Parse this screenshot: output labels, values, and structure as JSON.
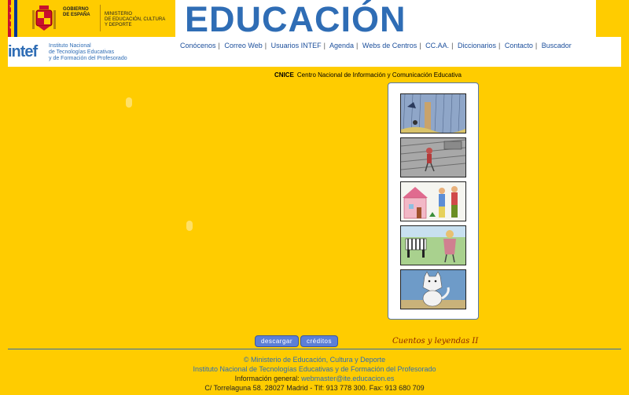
{
  "header": {
    "gov_line1": "GOBIERNO",
    "gov_line2": "DE ESPAÑA",
    "min_line1": "MINISTERIO",
    "min_line2": "DE EDUCACIÓN, CULTURA",
    "min_line3": "Y DEPORTE",
    "banner_title": "EDUCACIÓN"
  },
  "intef": {
    "logo": "intef",
    "line1": "Instituto Nacional",
    "line2": "de Tecnologías Educativas",
    "line3": "y de Formación del Profesorado"
  },
  "nav": {
    "items": [
      "Conócenos",
      "Correo Web",
      "Usuarios INTEF",
      "Agenda",
      "Webs de Centros",
      "CC.AA.",
      "Diccionarios",
      "Contacto",
      "Buscador"
    ]
  },
  "cnice": {
    "abbr": "CNICE",
    "full": "Centro Nacional de Información y Comunicación Educativa"
  },
  "buttons": {
    "download": "descargar",
    "credits": "créditos"
  },
  "series_title": "Cuentos y leyendas II",
  "footer": {
    "line1": "© Ministerio de Educación, Cultura y Deporte",
    "line2": "Instituto Nacional de Tecnologías Educativas y de Formación del Profesorado",
    "info_label": "Información general: ",
    "info_email": "webmaster@ite.educacion.es",
    "address": "C/ Torrelaguna 58. 28027 Madrid - Tlf: 913 778 300. Fax: 913 680 709"
  },
  "colors": {
    "background": "#FFCC00",
    "accent_blue": "#2F6DB5",
    "button": "#5C7FD6"
  }
}
